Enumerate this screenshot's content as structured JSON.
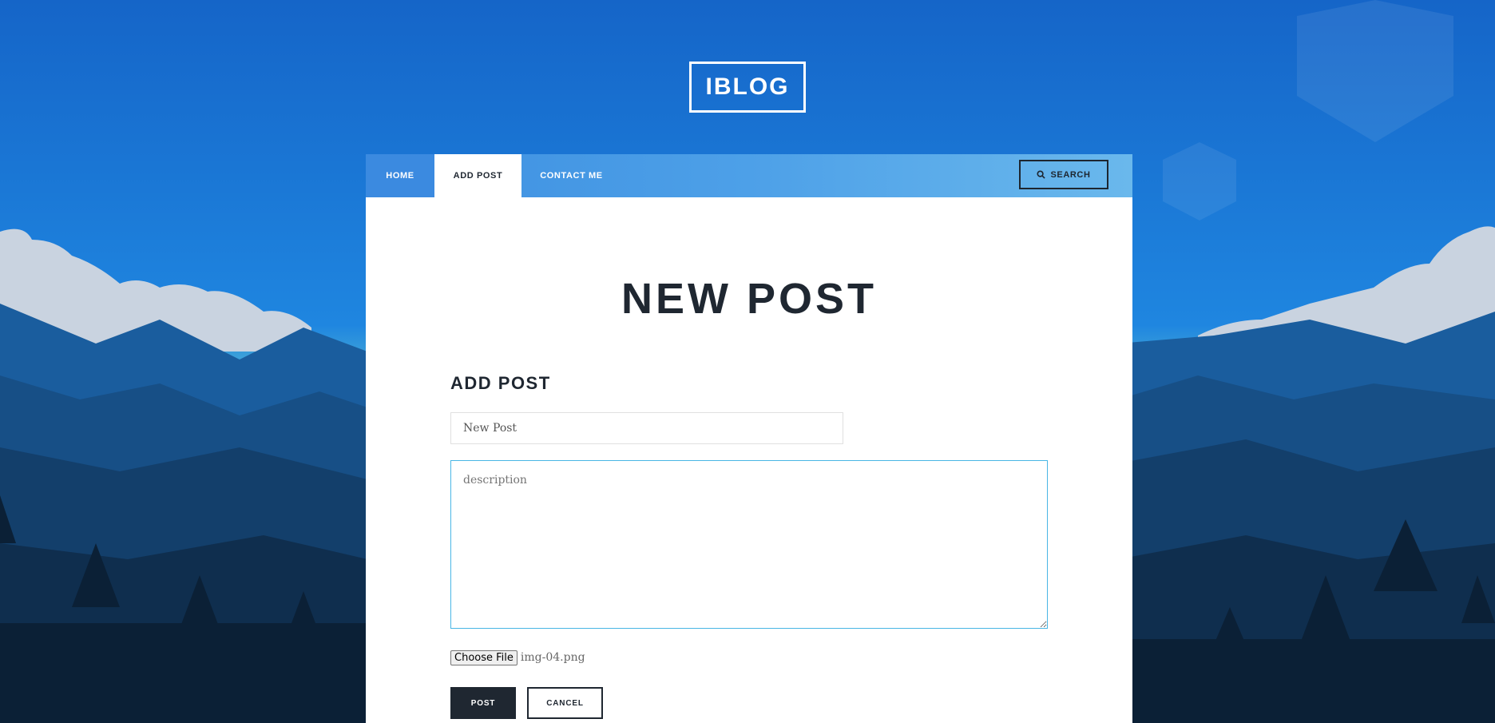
{
  "brand": {
    "logo": "IBLOG"
  },
  "nav": {
    "items": [
      {
        "label": "HOME"
      },
      {
        "label": "ADD POST"
      },
      {
        "label": "CONTACT ME"
      }
    ],
    "search_label": "SEARCH",
    "search_icon": "search-icon"
  },
  "page": {
    "title": "NEW POST"
  },
  "form": {
    "heading": "ADD POST",
    "title_value": "New Post",
    "description_placeholder": "description",
    "file_button_label": "Choose File",
    "file_name": "img-04.png",
    "post_label": "POST",
    "cancel_label": "CANCEL"
  },
  "colors": {
    "sky": "#1a6fd0",
    "nav_active_bg": "#ffffff",
    "dark": "#1f2731",
    "focus_border": "#49b6e5"
  }
}
